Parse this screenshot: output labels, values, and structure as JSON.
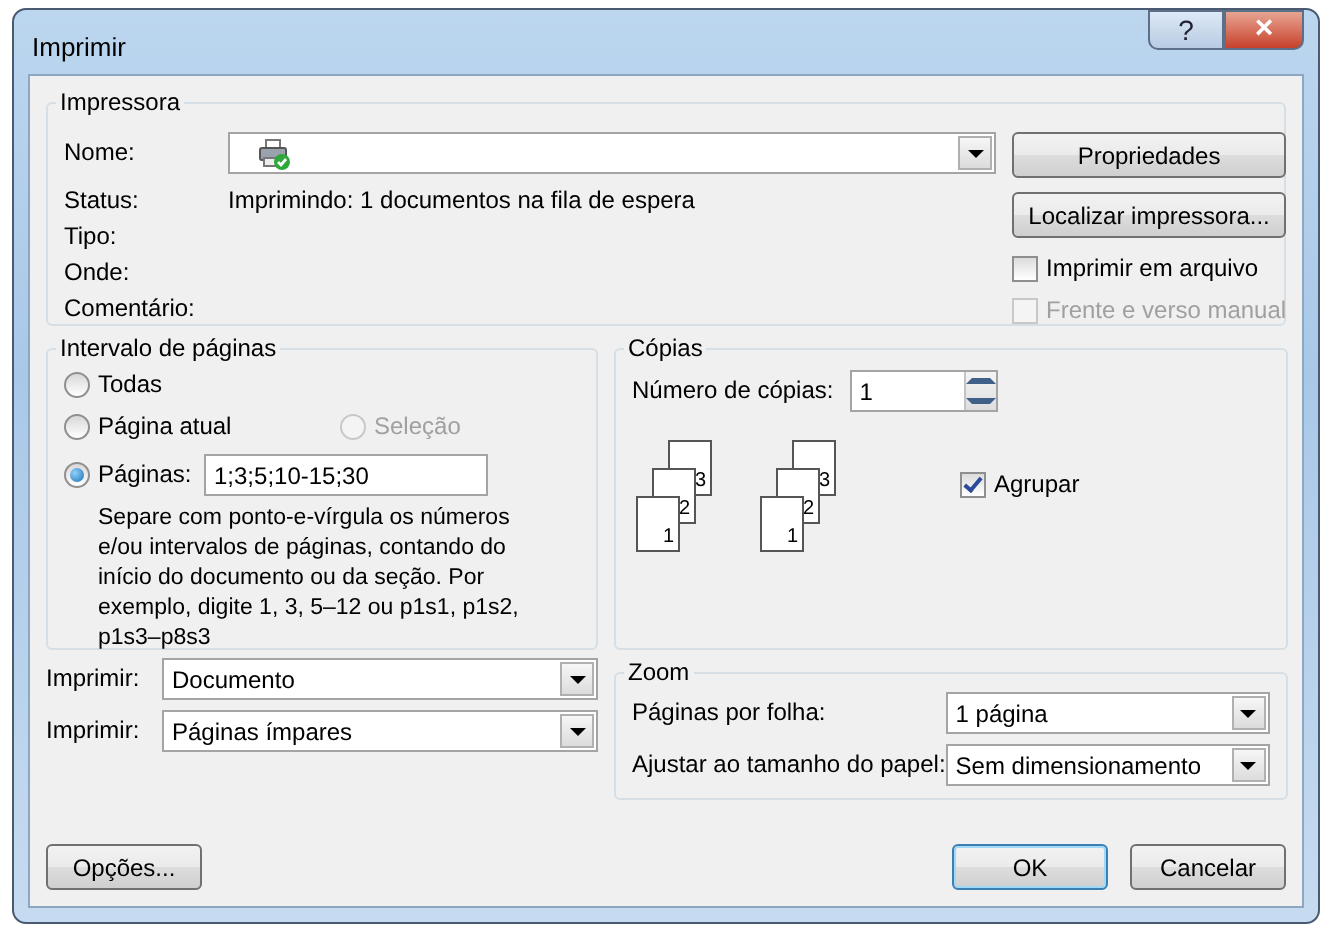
{
  "window": {
    "title": "Imprimir",
    "title_buttons": [
      {
        "kind": "help",
        "label": "?"
      },
      {
        "kind": "close",
        "label": "×"
      }
    ]
  },
  "printer": {
    "title": "Impressora",
    "name_label": "Nome:",
    "status_label": "Status:",
    "status_value": "Imprimindo: 1 documentos na fila de espera",
    "type_label": "Tipo:",
    "where_label": "Onde:",
    "comment_label": "Comentário:",
    "buttons": [
      "Propriedades",
      "Localizar impressora..."
    ],
    "options": [
      {
        "label": "Imprimir em arquivo",
        "checked": false,
        "disabled": false
      },
      {
        "label": "Frente e verso manual",
        "checked": false,
        "disabled": true
      }
    ]
  },
  "page_range": {
    "title": "Intervalo de páginas",
    "options": [
      {
        "label": "Todas",
        "selected": false,
        "disabled": false
      },
      {
        "label": "Página atual",
        "selected": false,
        "disabled": false
      },
      {
        "label": "Seleção",
        "selected": false,
        "disabled": true
      },
      {
        "label": "Páginas:",
        "selected": true,
        "disabled": false
      }
    ],
    "pages_value": "1;3;5;10-15;30",
    "hint": "Separe com ponto-e-vírgula os números e/ou intervalos de páginas, contando do início do documento ou da seção. Por exemplo, digite 1, 3, 5–12 ou p1s1, p1s2, p1s3–p8s3"
  },
  "print_selects": [
    {
      "label": "Imprimir:",
      "value": "Documento"
    },
    {
      "label": "Imprimir:",
      "value": "Páginas ímpares"
    }
  ],
  "copies": {
    "title": "Cópias",
    "count_label": "Número de cópias:",
    "count_value": "1",
    "stacks": [
      {
        "pages": [
          "1",
          "2",
          "3"
        ]
      },
      {
        "pages": [
          "1",
          "2",
          "3"
        ]
      }
    ],
    "collate": {
      "label": "Agrupar",
      "checked": true
    }
  },
  "zoom": {
    "title": "Zoom",
    "rows": [
      {
        "label": "Páginas por folha:",
        "value": "1 página"
      },
      {
        "label": "Ajustar ao tamanho do papel:",
        "value": "Sem dimensionamento"
      }
    ]
  },
  "footer": {
    "options_button": "Opções...",
    "buttons": [
      {
        "label": "OK",
        "default": true
      },
      {
        "label": "Cancelar",
        "default": false
      }
    ]
  }
}
